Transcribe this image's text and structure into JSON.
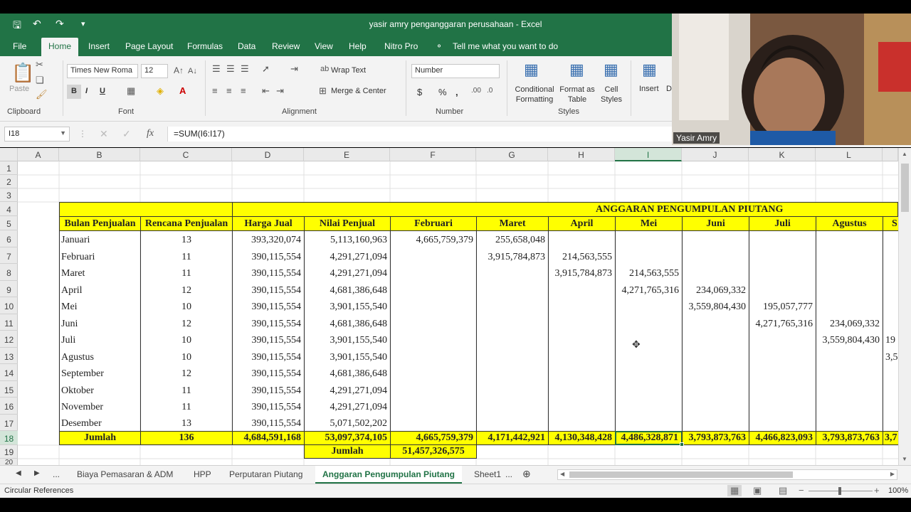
{
  "window": {
    "title": "yasir amry penganggaran perusahaan  -  Excel"
  },
  "menu": {
    "tabs": [
      "File",
      "Home",
      "Insert",
      "Page Layout",
      "Formulas",
      "Data",
      "Review",
      "View",
      "Help",
      "Nitro Pro"
    ],
    "active": "Home",
    "tell_me": "Tell me what you want to do"
  },
  "ribbon": {
    "clipboard": {
      "label": "Clipboard",
      "paste": "Paste"
    },
    "font": {
      "label": "Font",
      "name": "Times New Roma",
      "size": "12",
      "bold": "B",
      "italic": "I",
      "underline": "U"
    },
    "alignment": {
      "label": "Alignment",
      "wrap": "Wrap Text",
      "merge": "Merge & Center"
    },
    "number": {
      "label": "Number",
      "format": "Number",
      "currency": "$",
      "percent": "%",
      "comma": ","
    },
    "styles": {
      "label": "Styles",
      "conditional": "Conditional Formatting",
      "format_table": "Format as Table",
      "cell_styles": "Cell Styles"
    },
    "cells": {
      "insert": "Insert",
      "delete_partial": "D"
    }
  },
  "formula_bar": {
    "name_box": "I18",
    "formula": "=SUM(I6:I17)"
  },
  "columns": [
    "A",
    "B",
    "C",
    "D",
    "E",
    "F",
    "G",
    "H",
    "I",
    "J",
    "K",
    "L"
  ],
  "selected_column": "I",
  "rows": [
    "1",
    "2",
    "3",
    "4",
    "5",
    "6",
    "7",
    "8",
    "9",
    "10",
    "11",
    "12",
    "13",
    "14",
    "15",
    "16",
    "17",
    "18",
    "19",
    "20"
  ],
  "selected_row": "18",
  "sheet": {
    "title_banner": "ANGGARAN PENGUMPULAN PIUTANG",
    "headers": {
      "bulan": "Bulan Penjualan",
      "rencana": "Rencana Penjualan",
      "harga": "Harga Jual",
      "nilai": "Nilai Penjual",
      "months": [
        "Februari",
        "Maret",
        "April",
        "Mei",
        "Juni",
        "Juli",
        "Agustus",
        "S"
      ]
    },
    "data_rows": [
      {
        "bulan": "Januari",
        "rencana": "13",
        "harga": "393,320,074",
        "nilai": "5,113,160,963",
        "F": "4,665,759,379",
        "G": "255,658,048",
        "H": "",
        "I": "",
        "J": "",
        "K": "",
        "L": "",
        "M": ""
      },
      {
        "bulan": "Februari",
        "rencana": "11",
        "harga": "390,115,554",
        "nilai": "4,291,271,094",
        "F": "",
        "G": "3,915,784,873",
        "H": "214,563,555",
        "I": "",
        "J": "",
        "K": "",
        "L": "",
        "M": ""
      },
      {
        "bulan": "Maret",
        "rencana": "11",
        "harga": "390,115,554",
        "nilai": "4,291,271,094",
        "F": "",
        "G": "",
        "H": "3,915,784,873",
        "I": "214,563,555",
        "J": "",
        "K": "",
        "L": "",
        "M": ""
      },
      {
        "bulan": "April",
        "rencana": "12",
        "harga": "390,115,554",
        "nilai": "4,681,386,648",
        "F": "",
        "G": "",
        "H": "",
        "I": "4,271,765,316",
        "J": "234,069,332",
        "K": "",
        "L": "",
        "M": ""
      },
      {
        "bulan": "Mei",
        "rencana": "10",
        "harga": "390,115,554",
        "nilai": "3,901,155,540",
        "F": "",
        "G": "",
        "H": "",
        "I": "",
        "J": "3,559,804,430",
        "K": "195,057,777",
        "L": "",
        "M": ""
      },
      {
        "bulan": "Juni",
        "rencana": "12",
        "harga": "390,115,554",
        "nilai": "4,681,386,648",
        "F": "",
        "G": "",
        "H": "",
        "I": "",
        "J": "",
        "K": "4,271,765,316",
        "L": "234,069,332",
        "M": ""
      },
      {
        "bulan": "Juli",
        "rencana": "10",
        "harga": "390,115,554",
        "nilai": "3,901,155,540",
        "F": "",
        "G": "",
        "H": "",
        "I": "",
        "J": "",
        "K": "",
        "L": "3,559,804,430",
        "M": "19"
      },
      {
        "bulan": "Agustus",
        "rencana": "10",
        "harga": "390,115,554",
        "nilai": "3,901,155,540",
        "F": "",
        "G": "",
        "H": "",
        "I": "",
        "J": "",
        "K": "",
        "L": "",
        "M": "3,5"
      },
      {
        "bulan": "September",
        "rencana": "12",
        "harga": "390,115,554",
        "nilai": "4,681,386,648",
        "F": "",
        "G": "",
        "H": "",
        "I": "",
        "J": "",
        "K": "",
        "L": "",
        "M": ""
      },
      {
        "bulan": "Oktober",
        "rencana": "11",
        "harga": "390,115,554",
        "nilai": "4,291,271,094",
        "F": "",
        "G": "",
        "H": "",
        "I": "",
        "J": "",
        "K": "",
        "L": "",
        "M": ""
      },
      {
        "bulan": "November",
        "rencana": "11",
        "harga": "390,115,554",
        "nilai": "4,291,271,094",
        "F": "",
        "G": "",
        "H": "",
        "I": "",
        "J": "",
        "K": "",
        "L": "",
        "M": ""
      },
      {
        "bulan": "Desember",
        "rencana": "13",
        "harga": "390,115,554",
        "nilai": "5,071,502,202",
        "F": "",
        "G": "",
        "H": "",
        "I": "",
        "J": "",
        "K": "",
        "L": "",
        "M": ""
      }
    ],
    "total_row": {
      "label": "Jumlah",
      "rencana": "136",
      "harga": "4,684,591,168",
      "nilai": "53,097,374,105",
      "F": "4,665,759,379",
      "G": "4,171,442,921",
      "H": "4,130,348,428",
      "I": "4,486,328,871",
      "J": "3,793,873,763",
      "K": "4,466,823,093",
      "L": "3,793,873,763",
      "M": "3,7"
    },
    "grand_total": {
      "label": "Jumlah",
      "value": "51,457,326,575"
    }
  },
  "sheet_tabs": {
    "items": [
      "Biaya Pemasaran & ADM",
      "HPP",
      "Perputaran Piutang",
      "Anggaran Pengumpulan Piutang",
      "Sheet1"
    ],
    "active": "Anggaran Pengumpulan Piutang",
    "more": "...",
    "more_right": "..."
  },
  "status": {
    "left": "Circular References",
    "zoom": "100%"
  },
  "webcam": {
    "name": "Yasir Amry"
  },
  "colors": {
    "excel_green": "#217346",
    "highlight_yellow": "#ffff00"
  }
}
